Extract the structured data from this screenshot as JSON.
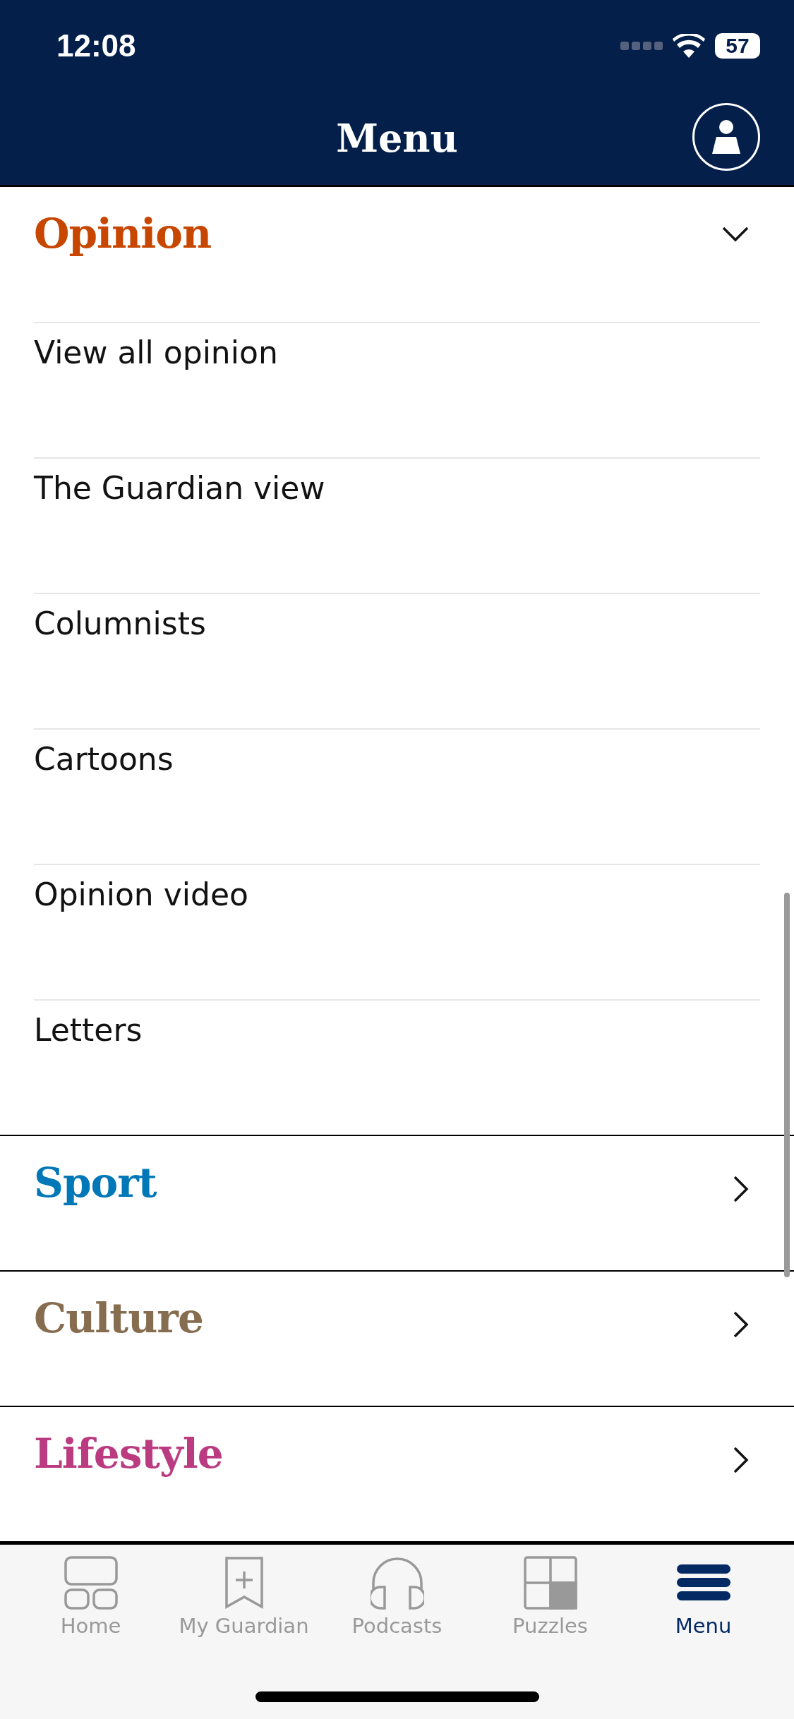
{
  "status_bar": {
    "time": "12:08",
    "battery": "57"
  },
  "nav_bar": {
    "title": "Menu"
  },
  "sections": [
    {
      "title": "Opinion",
      "color": "#c74600",
      "expanded": true,
      "items": [
        "View all opinion",
        "The Guardian view",
        "Columnists",
        "Cartoons",
        "Opinion video",
        "Letters"
      ]
    },
    {
      "title": "Sport",
      "color": "#0077b6",
      "expanded": false
    },
    {
      "title": "Culture",
      "color": "#866d50",
      "expanded": false
    },
    {
      "title": "Lifestyle",
      "color": "#bb3b80",
      "expanded": false
    }
  ],
  "tab_bar": [
    {
      "label": "Home",
      "kind": "home",
      "selected": false
    },
    {
      "label": "My Guardian",
      "kind": "bookmark",
      "selected": false
    },
    {
      "label": "Podcasts",
      "kind": "headphones",
      "selected": false
    },
    {
      "label": "Puzzles",
      "kind": "puzzle",
      "selected": false
    },
    {
      "label": "Menu",
      "kind": "menu",
      "selected": true
    }
  ]
}
